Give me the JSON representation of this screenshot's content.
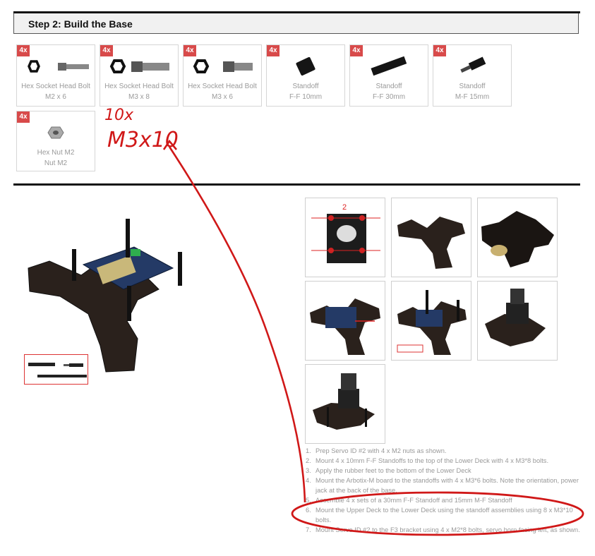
{
  "step": {
    "title": "Step 2: Build the Base"
  },
  "parts": [
    {
      "qty": "4x",
      "name": "Hex Socket Head Bolt",
      "spec": "M2 x 6",
      "icon": "bolt-m2x6-icon"
    },
    {
      "qty": "4x",
      "name": "Hex Socket Head Bolt",
      "spec": "M3 x 8",
      "icon": "bolt-m3x8-icon"
    },
    {
      "qty": "4x",
      "name": "Hex Socket Head Bolt",
      "spec": "M3 x 6",
      "icon": "bolt-m3x6-icon"
    },
    {
      "qty": "4x",
      "name": "Standoff",
      "spec": "F-F 10mm",
      "icon": "standoff-10mm-icon"
    },
    {
      "qty": "4x",
      "name": "Standoff",
      "spec": "F-F 30mm",
      "icon": "standoff-30mm-icon"
    },
    {
      "qty": "4x",
      "name": "Standoff",
      "spec": "M-F 15mm",
      "icon": "standoff-mf15-icon"
    },
    {
      "qty": "4x",
      "name": "Hex Nut M2",
      "spec": "Nut M2",
      "icon": "hex-nut-icon"
    }
  ],
  "annotation": {
    "qty": "10x",
    "spec": "M3x10",
    "color": "#d01818"
  },
  "thumb_label": "2",
  "instructions": [
    {
      "num": "1.",
      "text": "Prep Servo ID #2 with 4 x M2 nuts as shown."
    },
    {
      "num": "2.",
      "text": "Mount 4 x 10mm F-F Standoffs to the top of the Lower Deck with 4 x M3*8 bolts."
    },
    {
      "num": "3.",
      "text": "Apply the rubber feet to the bottom of the Lower Deck"
    },
    {
      "num": "4.",
      "text": "Mount the Arbotix-M board to the standoffs with 4 x M3*6 bolts. Note the orientation, power jack at the back of the base."
    },
    {
      "num": "5.",
      "text": "Assemble 4 x sets of a 30mm F-F Standoff and 15mm M-F Standoff"
    },
    {
      "num": "6.",
      "text": "Mount the Upper Deck to the Lower Deck using the standoff assemblies using 8 x M3*10 bolts."
    },
    {
      "num": "7.",
      "text": "Mount Servo ID #2 to the F3 bracket using 4 x M2*8 bolts, servo horn facing left, as shown."
    }
  ]
}
